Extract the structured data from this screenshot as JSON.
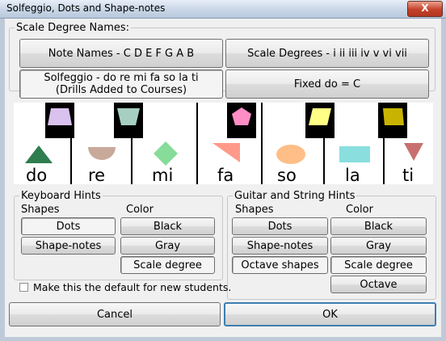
{
  "window": {
    "title": "Solfeggio, Dots and Shape-notes",
    "close_label": "X"
  },
  "scale_degree_names": {
    "legend": "Scale Degree Names:",
    "note_names": "Note Names - C D E F G A B",
    "scale_degrees": "Scale Degrees -  i ii iii iv v vi vii",
    "solfeggio_line1": "Solfeggio - do re mi fa so la ti",
    "solfeggio_line2": "(Drills Added to Courses)",
    "fixed_do": "Fixed do = C"
  },
  "notes": {
    "do": "do",
    "re": "re",
    "mi": "mi",
    "fa": "fa",
    "so": "so",
    "la": "la",
    "ti": "ti",
    "colors": {
      "do": "#2e7d4f",
      "re": "#c8a99a",
      "mi": "#86dc98",
      "fa": "#ff9a8a",
      "so": "#ffbe87",
      "la": "#8adede",
      "ti": "#c87070",
      "do_hi": "#d9c2ee",
      "re_hi": "#a6cfc2",
      "fa_hi": "#ff8dc6",
      "so_hi": "#ffff86",
      "ti_hi": "#c8b400"
    }
  },
  "keyboard_hints": {
    "legend": "Keyboard Hints",
    "shapes_header": "Shapes",
    "color_header": "Color",
    "dots": "Dots",
    "shape_notes": "Shape-notes",
    "black": "Black",
    "gray": "Gray",
    "scale_degree": "Scale degree"
  },
  "guitar_hints": {
    "legend": "Guitar and String Hints",
    "shapes_header": "Shapes",
    "color_header": "Color",
    "dots": "Dots",
    "shape_notes": "Shape-notes",
    "octave_shapes": "Octave shapes",
    "black": "Black",
    "gray": "Gray",
    "scale_degree": "Scale degree",
    "octave": "Octave"
  },
  "default_checkbox": {
    "label": "Make this the default for new students.",
    "checked": false
  },
  "footer": {
    "cancel": "Cancel",
    "ok": "OK"
  }
}
